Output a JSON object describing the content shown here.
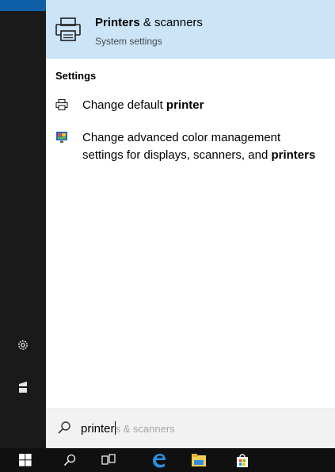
{
  "best_match": {
    "title_bold": "Printers",
    "title_rest": " & scanners",
    "subtitle": "System settings"
  },
  "section_heading": "Settings",
  "results": [
    {
      "label_prefix": "Change default ",
      "label_bold": "printer",
      "icon": "printer-icon"
    },
    {
      "label_line1": "Change advanced color management",
      "label_line2_prefix": "settings for displays, scanners, and ",
      "label_bold": "printers",
      "icon": "color-management-icon"
    }
  ],
  "search": {
    "typed": "printer",
    "autocomplete": "s & scanners"
  },
  "rail": {
    "icons": [
      "gear-icon",
      "user-icon"
    ]
  },
  "taskbar": {
    "icons": [
      "windows-start-icon",
      "search-icon",
      "task-view-icon",
      "edge-browser-icon",
      "file-explorer-icon",
      "store-icon"
    ]
  },
  "colors": {
    "selection": "#cce4f7",
    "rail": "#1a1a1a",
    "taskbar": "#101010",
    "accent": "#0f5ea8"
  }
}
